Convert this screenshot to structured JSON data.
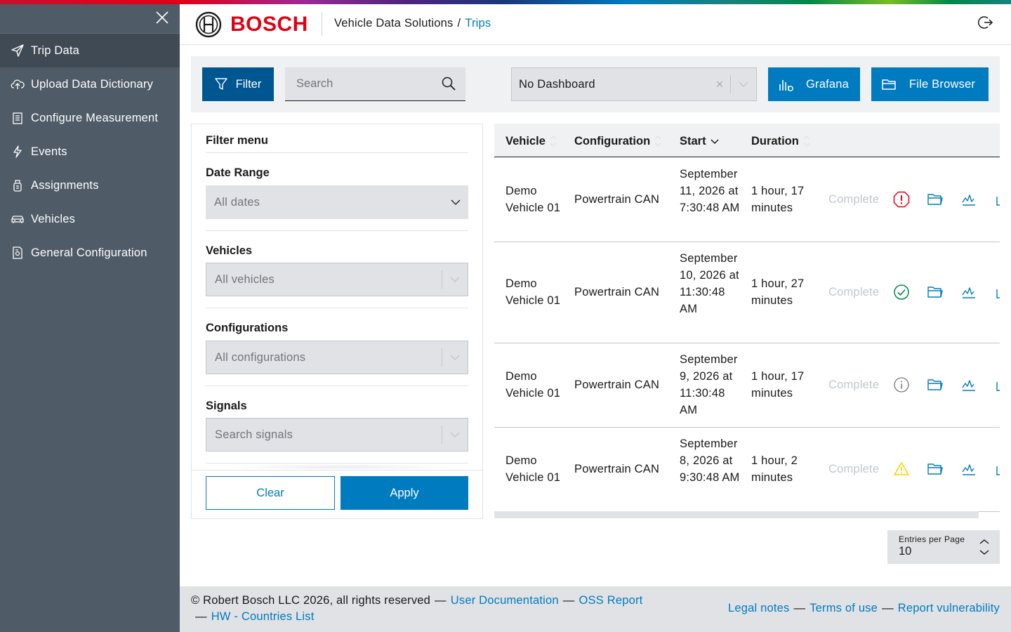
{
  "sidebar": {
    "items": [
      {
        "label": "Trip Data",
        "icon": "paper-plane-icon",
        "active": true
      },
      {
        "label": "Upload Data Dictionary",
        "icon": "cloud-upload-icon"
      },
      {
        "label": "Configure Measurement",
        "icon": "clipboard-list-icon"
      },
      {
        "label": "Events",
        "icon": "lightning-icon"
      },
      {
        "label": "Assignments",
        "icon": "dongle-icon"
      },
      {
        "label": "Vehicles",
        "icon": "car-icon"
      },
      {
        "label": "General Configuration",
        "icon": "settings-document-icon"
      }
    ]
  },
  "header": {
    "brand": "BOSCH",
    "app_name": "Vehicle Data Solutions",
    "separator": "/",
    "current_page": "Trips"
  },
  "toolbar": {
    "filter_label": "Filter",
    "search_placeholder": "Search",
    "dashboard_value": "No Dashboard",
    "dashboard_clear": "×",
    "grafana_label": "Grafana",
    "file_browser_label": "File Browser"
  },
  "filter_menu": {
    "title": "Filter menu",
    "date_range_label": "Date Range",
    "date_range_value": "All dates",
    "vehicles_label": "Vehicles",
    "vehicles_value": "All vehicles",
    "configurations_label": "Configurations",
    "configurations_value": "All configurations",
    "signals_label": "Signals",
    "signals_placeholder": "Search signals",
    "clear_label": "Clear",
    "apply_label": "Apply"
  },
  "table": {
    "columns": [
      "Vehicle",
      "Configuration",
      "Start",
      "Duration"
    ],
    "rows": [
      {
        "vehicle": "Demo Vehicle 01",
        "configuration": "Powertrain CAN",
        "start": "September 11, 2026 at 7:30:48 AM",
        "duration": "1 hour, 17 minutes",
        "status": "Complete",
        "indicator": "error"
      },
      {
        "vehicle": "Demo Vehicle 01",
        "configuration": "Powertrain CAN",
        "start": "September 10, 2026 at 11:30:48 AM",
        "duration": "1 hour, 27 minutes",
        "status": "Complete",
        "indicator": "success"
      },
      {
        "vehicle": "Demo Vehicle 01",
        "configuration": "Powertrain CAN",
        "start": "September 9, 2026 at 11:30:48 AM",
        "duration": "1 hour, 17 minutes",
        "status": "Complete",
        "indicator": "info"
      },
      {
        "vehicle": "Demo Vehicle 01",
        "configuration": "Powertrain CAN",
        "start": "September 8, 2026 at 9:30:48 AM",
        "duration": "1 hour, 2 minutes",
        "status": "Complete",
        "indicator": "warning"
      }
    ]
  },
  "pagination": {
    "entries_label": "Entries per Page",
    "entries_value": "10"
  },
  "footer": {
    "copyright": "© Robert Bosch LLC 2026, all rights reserved",
    "user_docs": "User Documentation",
    "oss_report": "OSS Report",
    "hw_countries": "HW - Countries List",
    "legal_notes": "Legal notes",
    "terms": "Terms of use",
    "report_vuln": "Report vulnerability",
    "dash": "—"
  },
  "colors": {
    "brand_red": "#e20015",
    "primary_blue": "#007bc0",
    "dark_blue": "#005691",
    "sidebar_bg": "#4f5b67",
    "error": "#e20015",
    "success": "#00884a",
    "info": "#71767c",
    "warning": "#ffcf00"
  }
}
